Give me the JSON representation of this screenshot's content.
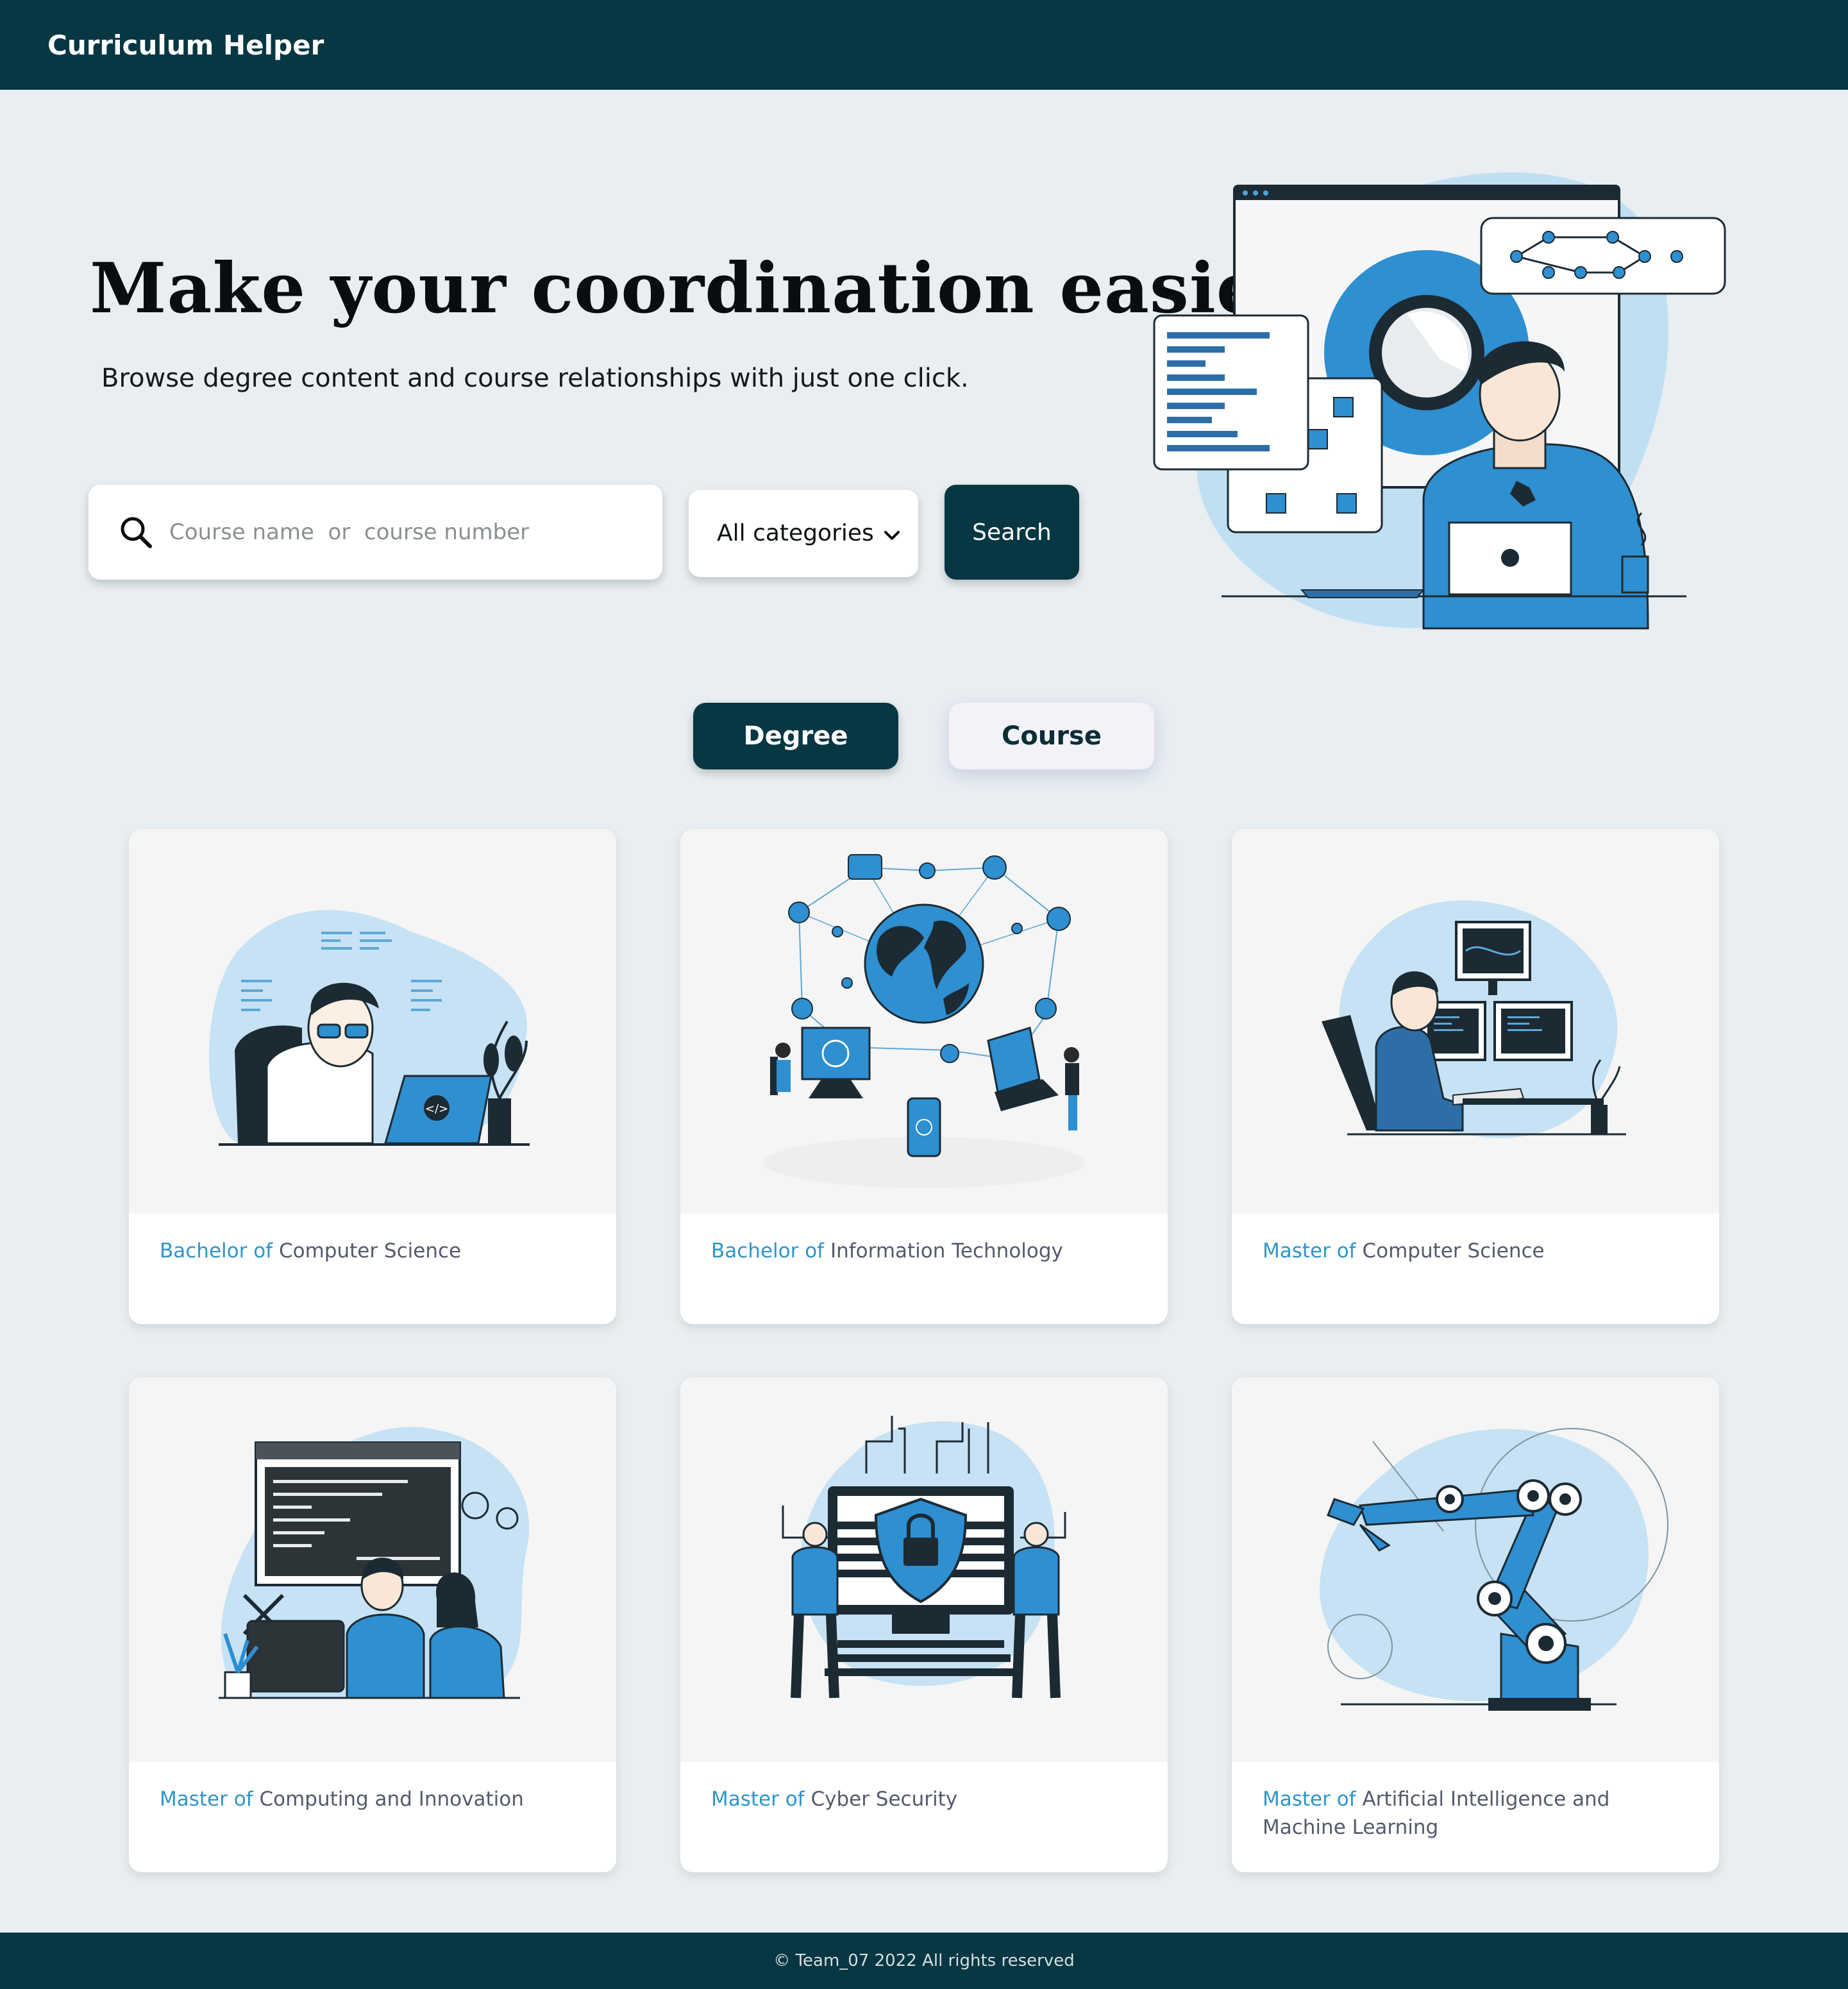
{
  "header": {
    "brand": "Curriculum Helper"
  },
  "hero": {
    "title": "Make your coordination easier",
    "subtitle": "Browse degree content and course relationships with just one click."
  },
  "search": {
    "placeholder": "Course name  or  course number",
    "value": "",
    "category_selected": "All categories",
    "button_label": "Search"
  },
  "tabs": [
    {
      "label": "Degree",
      "active": true
    },
    {
      "label": "Course",
      "active": false
    }
  ],
  "cards": [
    {
      "prefix": "Bachelor of",
      "name": "Computer Science"
    },
    {
      "prefix": "Bachelor of",
      "name": "Information Technology"
    },
    {
      "prefix": "Master of",
      "name": "Computer Science"
    },
    {
      "prefix": "Master of",
      "name": "Computing and Innovation"
    },
    {
      "prefix": "Master of",
      "name": "Cyber Security"
    },
    {
      "prefix": "Master of",
      "name": "Artificial Intelligence and Machine Learning"
    }
  ],
  "icons": {
    "search": "search-icon",
    "dropdown": "chevron-down-icon"
  },
  "colors": {
    "brand_dark": "#063743",
    "accent_blue": "#2f95c9",
    "page_bg": "#e8eef1"
  },
  "footer": {
    "text": "© Team_07  2022  All rights reserved"
  }
}
